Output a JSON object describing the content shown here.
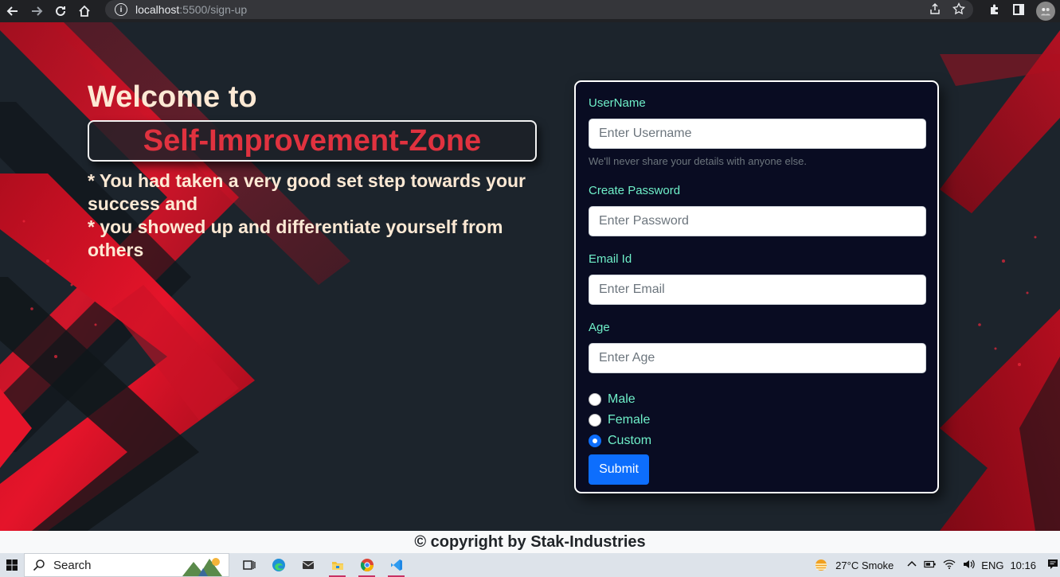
{
  "browser": {
    "url_host": "localhost",
    "url_path": ":5500/sign-up"
  },
  "hero": {
    "welcome": "Welcome to",
    "brand": "Self-Improvement-Zone",
    "line1": "* You had taken a very good set step towards your success and",
    "line2": "* you showed up and differentiate yourself from others"
  },
  "form": {
    "username_label": "UserName",
    "username_placeholder": "Enter Username",
    "username_help": "We'll never share your details with anyone else.",
    "password_label": "Create Password",
    "password_placeholder": "Enter Password",
    "email_label": "Email Id",
    "email_placeholder": "Enter Email",
    "age_label": "Age",
    "age_placeholder": "Enter Age",
    "gender_options": [
      "Male",
      "Female",
      "Custom"
    ],
    "gender_selected": "Custom",
    "submit_label": "Submit"
  },
  "footer": {
    "copyright": "© copyright by Stak-Industries"
  },
  "taskbar": {
    "search_label": "Search",
    "weather": "27°C  Smoke",
    "language": "ENG",
    "time": "10:16"
  },
  "colors": {
    "accent_label": "#6ff0c9",
    "brand_red": "#e0323f",
    "primary_button": "#0d6efd",
    "card_bg": "#090c22"
  }
}
